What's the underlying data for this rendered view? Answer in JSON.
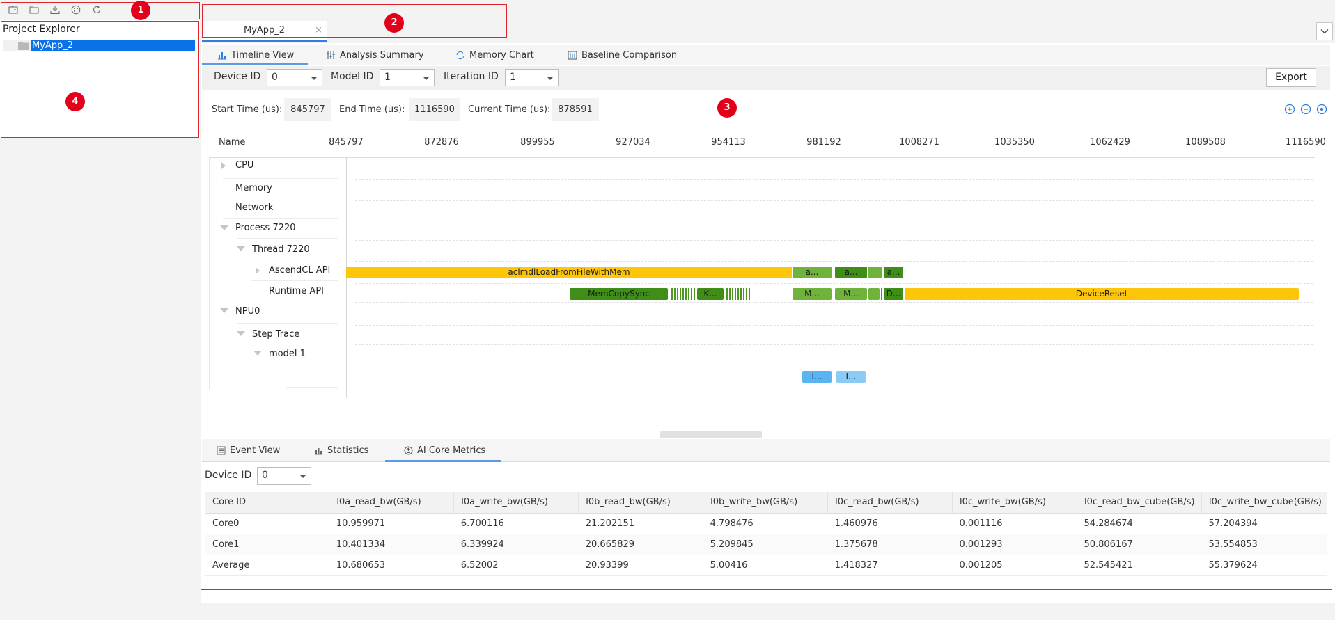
{
  "toolbar": {
    "icons": [
      "new-project-icon",
      "open-folder-icon",
      "import-icon",
      "palette-icon",
      "refresh-icon"
    ]
  },
  "explorer": {
    "title": "Project Explorer",
    "items": [
      {
        "label": "MyApp_2",
        "selected": true
      }
    ]
  },
  "editor": {
    "tab_label": "MyApp_2",
    "close_glyph": "×"
  },
  "view_tabs": [
    {
      "label": "Timeline View",
      "icon": "bar-chart-icon",
      "active": true
    },
    {
      "label": "Analysis Summary",
      "icon": "analysis-icon",
      "active": false
    },
    {
      "label": "Memory Chart",
      "icon": "memory-chart-icon",
      "active": false
    },
    {
      "label": "Baseline Comparison",
      "icon": "comparison-icon",
      "active": false
    }
  ],
  "filters": {
    "device_label": "Device ID",
    "device_value": "0",
    "model_label": "Model ID",
    "model_value": "1",
    "iteration_label": "Iteration ID",
    "iteration_value": "1",
    "export_label": "Export"
  },
  "time": {
    "start_label": "Start Time (us):",
    "start_value": "845797",
    "end_label": "End Time (us):",
    "end_value": "1116590",
    "current_label": "Current Time (us):",
    "current_value": "878591"
  },
  "timeline": {
    "name_header": "Name",
    "ticks": [
      "845797",
      "872876",
      "899955",
      "927034",
      "954113",
      "981192",
      "1008271",
      "1035350",
      "1062429",
      "1089508",
      "1116590"
    ],
    "tracks": {
      "cpu": "CPU",
      "memory": "Memory",
      "network": "Network",
      "process": "Process 7220",
      "thread": "Thread 7220",
      "ascendcl": "AscendCL API",
      "runtime": "Runtime API",
      "npu": "NPU0",
      "step_trace": "Step Trace",
      "model": "model 1"
    },
    "events": {
      "acl_main": "aclmdlLoadFromFileWithMem",
      "acl_a1": "a...",
      "acl_a2": "a...",
      "acl_a3": "a...",
      "rt_memcpy": "MemCopySync",
      "rt_k": "K...",
      "rt_m1": "M...",
      "rt_m2": "M...",
      "rt_d": "D...",
      "rt_reset": "DeviceReset",
      "step_i1": "I...",
      "step_i2": "I..."
    }
  },
  "bottom_tabs": [
    {
      "label": "Event View",
      "icon": "list-icon",
      "active": false
    },
    {
      "label": "Statistics",
      "icon": "statistics-icon",
      "active": false
    },
    {
      "label": "AI Core Metrics",
      "icon": "ai-core-icon",
      "active": true
    }
  ],
  "metrics": {
    "device_label": "Device ID",
    "device_value": "0",
    "columns": [
      "Core ID",
      "l0a_read_bw(GB/s)",
      "l0a_write_bw(GB/s)",
      "l0b_read_bw(GB/s)",
      "l0b_write_bw(GB/s)",
      "l0c_read_bw(GB/s)",
      "l0c_write_bw(GB/s)",
      "l0c_read_bw_cube(GB/s)",
      "l0c_write_bw_cube(GB/s)"
    ],
    "rows": [
      [
        "Core0",
        "10.959971",
        "6.700116",
        "21.202151",
        "4.798476",
        "1.460976",
        "0.001116",
        "54.284674",
        "57.204394"
      ],
      [
        "Core1",
        "10.401334",
        "6.339924",
        "20.665829",
        "5.209845",
        "1.375678",
        "0.001293",
        "50.806167",
        "53.554853"
      ],
      [
        "Average",
        "10.680653",
        "6.52002",
        "20.93399",
        "5.00416",
        "1.418327",
        "0.001205",
        "52.545421",
        "55.379624"
      ]
    ]
  },
  "annotations": [
    "1",
    "2",
    "3",
    "4"
  ],
  "colors": {
    "selection": "#0a72e8",
    "accent_tab": "#5b9be6",
    "annotation_red": "#e3001b",
    "event_yellow": "#fdc60a",
    "event_green": "#3e8e17",
    "event_blue": "#5ab4f2",
    "line_blue": "#5e8fd8"
  }
}
